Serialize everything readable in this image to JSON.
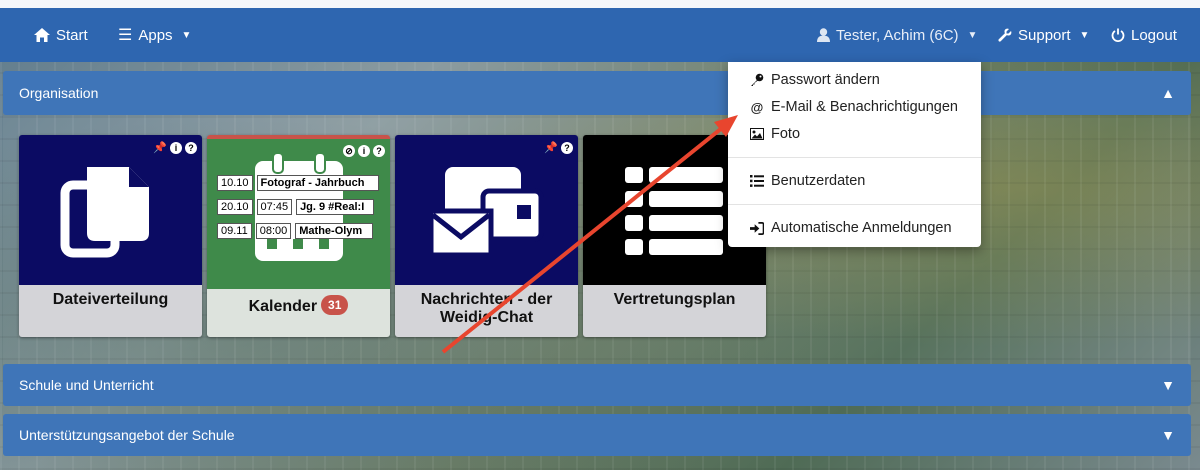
{
  "nav": {
    "start_label": "Start",
    "apps_label": "Apps",
    "user_label": "Tester, Achim (6C)",
    "support_label": "Support",
    "logout_label": "Logout"
  },
  "panels": {
    "organisation": "Organisation",
    "schule": "Schule und Unterricht",
    "unterstuetzung": "Unterstützungsangebot der Schule"
  },
  "tiles": {
    "dateiverteilung": "Dateiverteilung",
    "kalender": "Kalender",
    "kalender_count": "31",
    "nachrichten": "Nachrichten - der Weidig-Chat",
    "vertretungsplan": "Vertretungsplan"
  },
  "calendar_preview": [
    {
      "date": "10.10",
      "time": "",
      "title": "Fotograf - Jahrbuch"
    },
    {
      "date": "20.10",
      "time": "07:45",
      "title": "Jg. 9 #Real:I"
    },
    {
      "date": "09.11",
      "time": "08:00",
      "title": "Mathe-Olym"
    }
  ],
  "dropdown": {
    "passwort": "Passwort ändern",
    "email": "E-Mail & Benachrichtigungen",
    "foto": "Foto",
    "benutzerdaten": "Benutzerdaten",
    "auto_anmeldung": "Automatische Anmeldungen"
  },
  "colors": {
    "nav_blue": "#2e66b0",
    "panel_blue": "#3f75b8",
    "tile_navy": "#0b0b63",
    "tile_green": "#3f8a4a",
    "badge_red": "#c8534a",
    "arrow_red": "#e8452e"
  }
}
